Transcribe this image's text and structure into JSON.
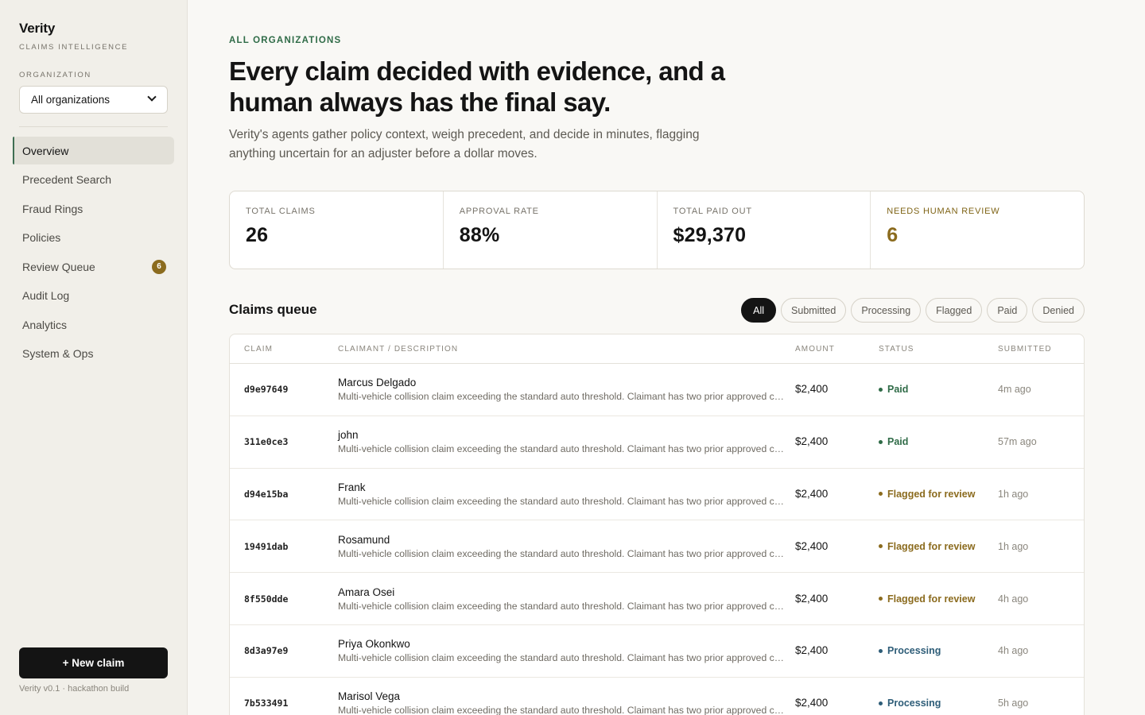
{
  "sidebar": {
    "brand": "Verity",
    "brand_sub": "CLAIMS INTELLIGENCE",
    "org_label": "ORGANIZATION",
    "org_selected": "All organizations",
    "nav": [
      {
        "label": "Overview",
        "active": true
      },
      {
        "label": "Precedent Search"
      },
      {
        "label": "Fraud Rings"
      },
      {
        "label": "Policies"
      },
      {
        "label": "Review Queue",
        "badge": "6"
      },
      {
        "label": "Audit Log"
      },
      {
        "label": "Analytics"
      },
      {
        "label": "System & Ops"
      }
    ],
    "new_claim": "+ New claim",
    "version": "Verity v0.1 · hackathon build"
  },
  "header": {
    "eyebrow": "ALL ORGANIZATIONS",
    "headline": "Every claim decided with evidence, and a human always has the final say.",
    "lede": "Verity's agents gather policy context, weigh precedent, and decide in minutes, flagging anything uncertain for an adjuster before a dollar moves."
  },
  "stats": [
    {
      "label": "TOTAL CLAIMS",
      "value": "26"
    },
    {
      "label": "APPROVAL RATE",
      "value": "88%"
    },
    {
      "label": "TOTAL PAID OUT",
      "value": "$29,370"
    },
    {
      "label": "NEEDS HUMAN REVIEW",
      "value": "6"
    }
  ],
  "queue": {
    "title": "Claims queue",
    "filters": [
      "All",
      "Submitted",
      "Processing",
      "Flagged",
      "Paid",
      "Denied"
    ],
    "active_filter": "All",
    "columns": [
      "CLAIM",
      "CLAIMANT / DESCRIPTION",
      "AMOUNT",
      "STATUS",
      "SUBMITTED"
    ],
    "rows": [
      {
        "id": "d9e97649",
        "claimant": "Marcus Delgado",
        "desc": "Multi-vehicle collision claim exceeding the standard auto threshold. Claimant has two prior approved claims",
        "amount": "$2,400",
        "status": "Paid",
        "kind": "paid",
        "time": "4m ago"
      },
      {
        "id": "311e0ce3",
        "claimant": "john",
        "desc": "Multi-vehicle collision claim exceeding the standard auto threshold. Claimant has two prior approved claims",
        "amount": "$2,400",
        "status": "Paid",
        "kind": "paid",
        "time": "57m ago"
      },
      {
        "id": "d94e15ba",
        "claimant": "Frank",
        "desc": "Multi-vehicle collision claim exceeding the standard auto threshold. Claimant has two prior approved claims",
        "amount": "$2,400",
        "status": "Flagged for review",
        "kind": "flagged",
        "time": "1h ago"
      },
      {
        "id": "19491dab",
        "claimant": "Rosamund",
        "desc": "Multi-vehicle collision claim exceeding the standard auto threshold. Claimant has two prior approved claims",
        "amount": "$2,400",
        "status": "Flagged for review",
        "kind": "flagged",
        "time": "1h ago"
      },
      {
        "id": "8f550dde",
        "claimant": "Amara Osei",
        "desc": "Multi-vehicle collision claim exceeding the standard auto threshold. Claimant has two prior approved claims",
        "amount": "$2,400",
        "status": "Flagged for review",
        "kind": "flagged",
        "time": "4h ago"
      },
      {
        "id": "8d3a97e9",
        "claimant": "Priya Okonkwo",
        "desc": "Multi-vehicle collision claim exceeding the standard auto threshold. Claimant has two prior approved claims",
        "amount": "$2,400",
        "status": "Processing",
        "kind": "processing",
        "time": "4h ago"
      },
      {
        "id": "7b533491",
        "claimant": "Marisol Vega",
        "desc": "Multi-vehicle collision claim exceeding the standard auto threshold. Claimant has two prior approved claims",
        "amount": "$2,400",
        "status": "Processing",
        "kind": "processing",
        "time": "5h ago"
      }
    ]
  },
  "colors": {
    "accent_green": "#2f6b47",
    "warn_gold": "#8b6b1e",
    "processing_blue": "#2e5d78",
    "ink": "#141414"
  }
}
